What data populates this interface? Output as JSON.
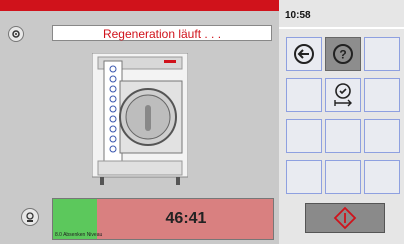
{
  "header": {
    "status_text": "Regeneration  läuft . . ."
  },
  "clock": {
    "time": "10:58"
  },
  "progress": {
    "time_remaining": "46:41",
    "label": "8.0 Absenken Niveau",
    "fraction": 0.2
  },
  "left_icons": [
    "settings-gear-icon",
    "reg-icon"
  ],
  "grid": {
    "back_icon": "back-arrow-icon",
    "help_icon": "help-icon",
    "timer_icon": "timer-clock-icon"
  },
  "colors": {
    "accent_red": "#d0121b",
    "progress_green": "#5cc85c",
    "progress_red": "#d98080"
  }
}
